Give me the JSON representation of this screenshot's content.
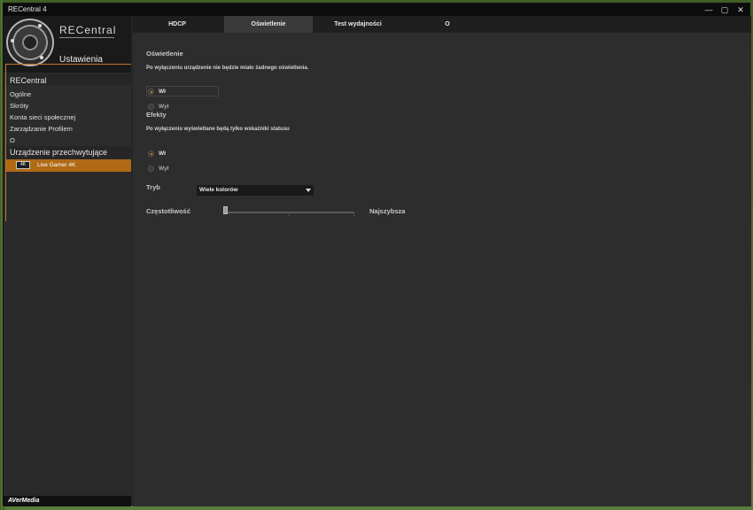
{
  "window": {
    "title": "RECentral 4",
    "controls": [
      "—",
      "▢",
      "✕"
    ]
  },
  "sidebar": {
    "brand": "RECentral",
    "subtitle": "Ustawienia",
    "section_recentral": "RECentral",
    "items": [
      "Ogólne",
      "Skróty",
      "Konta sieci społecznej",
      "Zarządzanie Profilem",
      "O"
    ],
    "section_device": "Urządzenie przechwytujące",
    "device": {
      "icon_text": "4K",
      "label": "Live Gamer 4K"
    },
    "footer": "AVerMedia"
  },
  "tabs": [
    "HDCP",
    "Oświetlenie",
    "Test wydajności",
    "O"
  ],
  "active_tab": "Oświetlenie",
  "lighting": {
    "heading": "Oświetlenie",
    "desc": "Po wyłączeniu urządzenie nie będzie miało żadnego oświetlenia.",
    "on": "Wł",
    "off": "Wył",
    "selected": "Wł"
  },
  "effects": {
    "heading": "Efekty",
    "desc": "Po wyłączeniu wyświetlane będą tylko wskaźniki statusu",
    "on": "Wł",
    "off": "Wył",
    "selected": "Wł"
  },
  "mode": {
    "label": "Tryb",
    "value": "Wiele kolorów"
  },
  "frequency": {
    "label": "Częstotliwość",
    "max_label": "Najszybsza",
    "level": 0
  },
  "colors": {
    "accent": "#c07a22",
    "device_row": "#b06a16"
  }
}
